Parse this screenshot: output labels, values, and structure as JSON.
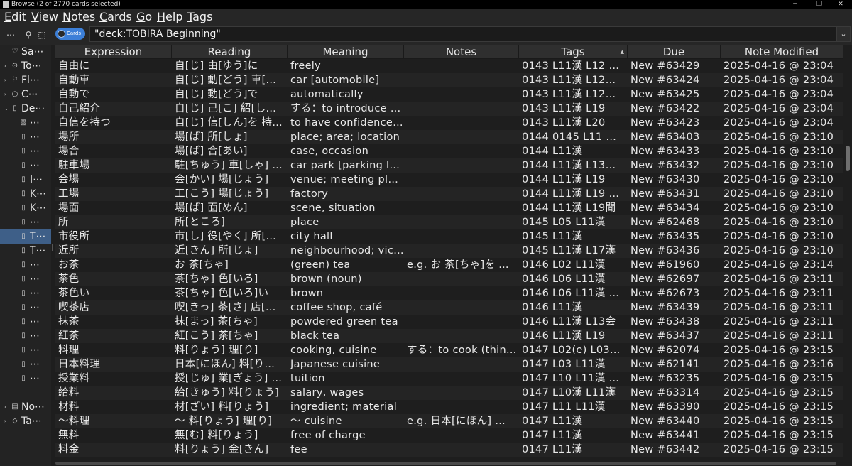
{
  "window": {
    "title": "Browse (2 of 2770 cards selected)",
    "minimize": "─",
    "maximize": "❐",
    "close": "✕"
  },
  "menu": [
    "Edit",
    "View",
    "Notes",
    "Cards",
    "Go",
    "Help",
    "Tags"
  ],
  "toolbar": {
    "more": "⋯",
    "search_icon": "⚲",
    "select_icon": "⬚",
    "toggle_label": "Cards",
    "search_query": "\"deck:TOBIRA Beginning\"",
    "dropdown": "⌄"
  },
  "sidebar": [
    {
      "arrow": "",
      "icon": "♡",
      "label": "Sa⋯",
      "indent": 0
    },
    {
      "arrow": "›",
      "icon": "⊙",
      "label": "To⋯",
      "indent": 0
    },
    {
      "arrow": "›",
      "icon": "⚐",
      "label": "Fl⋯",
      "indent": 0
    },
    {
      "arrow": "›",
      "icon": "○",
      "label": "C⋯",
      "indent": 0
    },
    {
      "arrow": "⌄",
      "icon": "▯",
      "label": "De⋯",
      "indent": 0
    },
    {
      "arrow": "",
      "icon": "▧",
      "label": "⋯",
      "indent": 1
    },
    {
      "arrow": "",
      "icon": "▯",
      "label": "⋯",
      "indent": 1
    },
    {
      "arrow": "",
      "icon": "▯",
      "label": "⋯",
      "indent": 1
    },
    {
      "arrow": "",
      "icon": "▯",
      "label": "⋯",
      "indent": 1
    },
    {
      "arrow": "",
      "icon": "▯",
      "label": "I⋯",
      "indent": 1
    },
    {
      "arrow": "",
      "icon": "▯",
      "label": "K⋯",
      "indent": 1
    },
    {
      "arrow": "",
      "icon": "▯",
      "label": "K⋯",
      "indent": 1
    },
    {
      "arrow": "",
      "icon": "▯",
      "label": "⋯",
      "indent": 1
    },
    {
      "arrow": "",
      "icon": "▯",
      "label": "T⋯",
      "indent": 1,
      "selected": true
    },
    {
      "arrow": "",
      "icon": "▯",
      "label": "T⋯",
      "indent": 1
    },
    {
      "arrow": "",
      "icon": "▯",
      "label": "⋯",
      "indent": 1
    },
    {
      "arrow": "",
      "icon": "▯",
      "label": "⋯",
      "indent": 1
    },
    {
      "arrow": "",
      "icon": "▯",
      "label": "⋯",
      "indent": 1
    },
    {
      "arrow": "",
      "icon": "▯",
      "label": "⋯",
      "indent": 1
    },
    {
      "arrow": "",
      "icon": "▯",
      "label": "⋯",
      "indent": 1
    },
    {
      "arrow": "",
      "icon": "▯",
      "label": "⋯",
      "indent": 1
    },
    {
      "arrow": "",
      "icon": "▯",
      "label": "⋯",
      "indent": 1
    },
    {
      "arrow": "",
      "icon": "▯",
      "label": "⋯",
      "indent": 1
    },
    {
      "arrow": "",
      "icon": "▯",
      "label": "⋯",
      "indent": 1
    },
    {
      "arrow": "",
      "icon": "",
      "label": "",
      "indent": 1
    },
    {
      "arrow": "›",
      "icon": "▤",
      "label": "No⋯",
      "indent": 0
    },
    {
      "arrow": "›",
      "icon": "◇",
      "label": "Ta⋯",
      "indent": 0
    }
  ],
  "columns": [
    "Expression",
    "Reading",
    "Meaning",
    "Notes",
    "Tags",
    "Due",
    "Note Modified"
  ],
  "sort_indicator": "▲",
  "rows": [
    [
      "自由に",
      "自[じ] 由[ゆう]に",
      "freely",
      "",
      "0143 L11漢 L12 …",
      "New #63429",
      "2025-04-16 @ 23:04"
    ],
    [
      "自動車",
      "自[じ] 動[どう] 車[…",
      "car [automobile]",
      "",
      "0143 L11漢 L12…",
      "New #63424",
      "2025-04-16 @ 23:04"
    ],
    [
      "自動で",
      "自[じ] 動[どう]で",
      "automatically",
      "",
      "0143 L11漢 L12…",
      "New #63425",
      "2025-04-16 @ 23:04"
    ],
    [
      "自己紹介",
      "自[じ] 己[こ] 紹[し…",
      "する：to introduce …",
      "",
      "0143 L11漢 L19",
      "New #63422",
      "2025-04-16 @ 23:04"
    ],
    [
      "自信を持つ",
      "自[じ] 信[しん]を 持…",
      "to have confidence …",
      "",
      "0143 L11漢 L20",
      "New #63423",
      "2025-04-16 @ 23:04"
    ],
    [
      "場所",
      "場[ば] 所[しょ]",
      "place; area; location",
      "",
      "0144 0145 L11 …",
      "New #63403",
      "2025-04-16 @ 23:10"
    ],
    [
      "場合",
      "場[ば] 合[あい]",
      "case, occasion",
      "",
      "0144 L11漢",
      "New #63433",
      "2025-04-16 @ 23:10"
    ],
    [
      "駐車場",
      "駐[ちゅう] 車[しゃ] …",
      "car park [parking l…",
      "",
      "0144 L11漢 L13…",
      "New #63432",
      "2025-04-16 @ 23:10"
    ],
    [
      "会場",
      "会[かい] 場[じょう]",
      "venue; meeting place",
      "",
      "0144 L11漢 L19",
      "New #63430",
      "2025-04-16 @ 23:10"
    ],
    [
      "工場",
      "工[こう] 場[じょう]",
      "factory",
      "",
      "0144 L11漢 L19 …",
      "New #63431",
      "2025-04-16 @ 23:10"
    ],
    [
      "場面",
      "場[ば] 面[めん]",
      "scene, situation",
      "",
      "0144 L11漢 L19聞",
      "New #63434",
      "2025-04-16 @ 23:10"
    ],
    [
      "所",
      "所[ところ]",
      "place",
      "",
      "0145 L05 L11漢",
      "New #62468",
      "2025-04-16 @ 23:10"
    ],
    [
      "市役所",
      "市[し] 役[やく] 所[…",
      "city hall",
      "",
      "0145 L11漢",
      "New #63435",
      "2025-04-16 @ 23:10"
    ],
    [
      "近所",
      "近[きん] 所[じょ]",
      "neighbourhood; vici…",
      "",
      "0145 L11漢 L17漢",
      "New #63436",
      "2025-04-16 @ 23:10"
    ],
    [
      "お茶",
      "お 茶[ちゃ]",
      "(green) tea",
      "e.g. お 茶[ちゃ]を …",
      "0146 L02 L11漢",
      "New #61960",
      "2025-04-16 @ 23:14"
    ],
    [
      "茶色",
      "茶[ちゃ] 色[いろ]",
      "brown (noun)",
      "",
      "0146 L06 L11漢",
      "New #62697",
      "2025-04-16 @ 23:11"
    ],
    [
      "茶色い",
      "茶[ちゃ] 色[いろ]い",
      "brown",
      "",
      "0146 L06 L11漢 …",
      "New #62673",
      "2025-04-16 @ 23:11"
    ],
    [
      "喫茶店",
      "喫[きっ] 茶[さ] 店[…",
      "coffee shop, café",
      "",
      "0146 L11漢",
      "New #63439",
      "2025-04-16 @ 23:11"
    ],
    [
      "抹茶",
      "抹[まっ] 茶[ちゃ]",
      "powdered green tea",
      "",
      "0146 L11漢 L13会",
      "New #63438",
      "2025-04-16 @ 23:11"
    ],
    [
      "紅茶",
      "紅[こう] 茶[ちゃ]",
      "black tea",
      "",
      "0146 L11漢 L19",
      "New #63437",
      "2025-04-16 @ 23:11"
    ],
    [
      "料理",
      "料[りょう] 理[り]",
      "cooking, cuisine",
      "する：to cook (thin…",
      "0147 L02(e) L03…",
      "New #62074",
      "2025-04-16 @ 23:15"
    ],
    [
      "日本料理",
      "日本[にほん] 料[り…",
      "Japanese cuisine",
      "",
      "0147 L03 L11漢",
      "New #62141",
      "2025-04-16 @ 23:16"
    ],
    [
      "授業料",
      "授[じゅ] 業[ぎょう] …",
      "tuition",
      "",
      "0147 L10 L11漢 …",
      "New #63235",
      "2025-04-16 @ 23:15"
    ],
    [
      "給料",
      "給[きゅう] 料[りょう]",
      "salary, wages",
      "",
      "0147 L10漢 L11漢",
      "New #63314",
      "2025-04-16 @ 23:15"
    ],
    [
      "材料",
      "材[ざい] 料[りょう]",
      "ingredient; material",
      "",
      "0147 L11 L11漢",
      "New #63390",
      "2025-04-16 @ 23:15"
    ],
    [
      "～料理",
      "～ 料[りょう] 理[り]",
      "～ cuisine",
      "e.g. 日本[にほん] …",
      "0147 L11漢",
      "New #63440",
      "2025-04-16 @ 23:15"
    ],
    [
      "無料",
      "無[む] 料[りょう]",
      "free of charge",
      "",
      "0147 L11漢",
      "New #63441",
      "2025-04-16 @ 23:15"
    ],
    [
      "料金",
      "料[りょう] 金[きん]",
      "fee",
      "",
      "0147 L11漢",
      "New #63442",
      "2025-04-16 @ 23:15"
    ]
  ],
  "colors": {
    "background": "#1e1e1e",
    "row_alt": "#242424",
    "header": "#2f2f2f",
    "selection": "#3e5f88",
    "toggle": "#3c7fd8"
  }
}
